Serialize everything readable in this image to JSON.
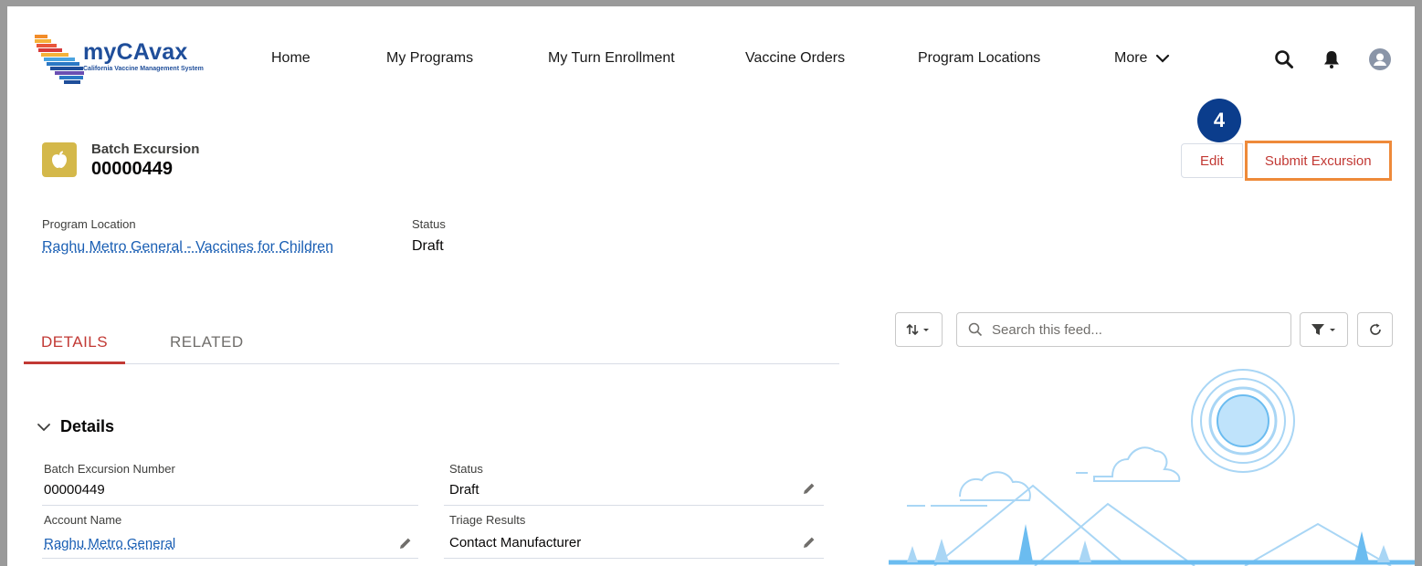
{
  "app": {
    "logo_title": "myCAvax",
    "logo_subtitle": "California Vaccine Management System"
  },
  "nav": {
    "home": "Home",
    "my_programs": "My Programs",
    "my_turn": "My Turn Enrollment",
    "vaccine_orders": "Vaccine Orders",
    "program_locations": "Program Locations",
    "more": "More"
  },
  "record": {
    "type": "Batch Excursion",
    "name": "00000449",
    "program_location_label": "Program Location",
    "program_location_value": "Raghu Metro General - Vaccines for Children",
    "status_label": "Status",
    "status_value": "Draft"
  },
  "step_badge": "4",
  "actions": {
    "edit": "Edit",
    "submit": "Submit Excursion"
  },
  "tabs": {
    "details": "DETAILS",
    "related": "RELATED"
  },
  "details": {
    "section_title": "Details",
    "fields": [
      {
        "label": "Batch Excursion Number",
        "value": "00000449"
      },
      {
        "label": "Status",
        "value": "Draft"
      },
      {
        "label": "Account Name",
        "value": "Raghu Metro General"
      },
      {
        "label": "Triage Results",
        "value": "Contact Manufacturer"
      }
    ]
  },
  "feed": {
    "search_placeholder": "Search this feed..."
  },
  "colors": {
    "brand_red": "#c23934",
    "highlight_orange": "#ee8a3a",
    "badge_blue": "#0b3d8c",
    "record_icon": "#d4b84a",
    "link_blue": "#1a5fb4"
  }
}
